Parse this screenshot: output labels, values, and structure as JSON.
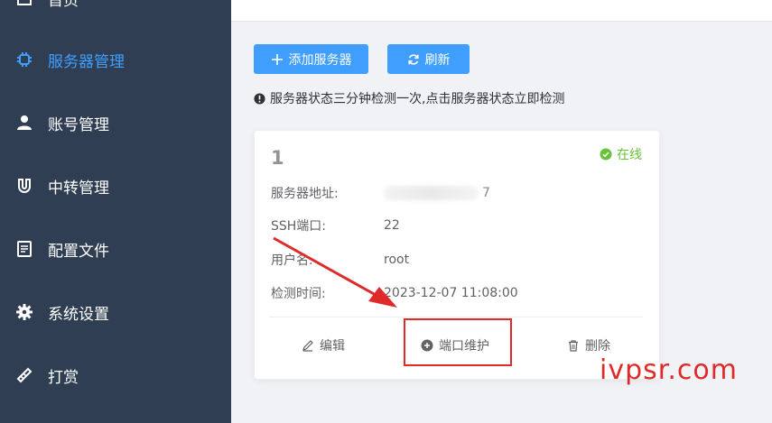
{
  "sidebar": {
    "items": [
      {
        "label": "首页",
        "icon": "home-icon",
        "active": false
      },
      {
        "label": "服务器管理",
        "icon": "cpu-icon",
        "active": true
      },
      {
        "label": "账号管理",
        "icon": "user-icon",
        "active": false
      },
      {
        "label": "中转管理",
        "icon": "magnet-icon",
        "active": false
      },
      {
        "label": "配置文件",
        "icon": "document-icon",
        "active": false
      },
      {
        "label": "系统设置",
        "icon": "gear-icon",
        "active": false
      },
      {
        "label": "打赏",
        "icon": "gift-icon",
        "active": false
      }
    ]
  },
  "toolbar": {
    "add_label": "添加服务器",
    "refresh_label": "刷新"
  },
  "tip": "服务器状态三分钟检测一次,点击服务器状态立即检测",
  "card": {
    "title": "1",
    "status": "在线",
    "rows": [
      {
        "label": "服务器地址:",
        "value": "7"
      },
      {
        "label": "SSH端口:",
        "value": "22"
      },
      {
        "label": "用户名:",
        "value": "root"
      },
      {
        "label": "检测时间:",
        "value": "2023-12-07 11:08:00"
      }
    ],
    "actions": {
      "edit": "编辑",
      "port": "端口维护",
      "delete": "删除"
    }
  },
  "watermark": "ivpsr.com",
  "colors": {
    "sidebar_bg": "#2f3e52",
    "primary": "#409eff",
    "success": "#67c23a",
    "annotation": "#e02a2a"
  }
}
